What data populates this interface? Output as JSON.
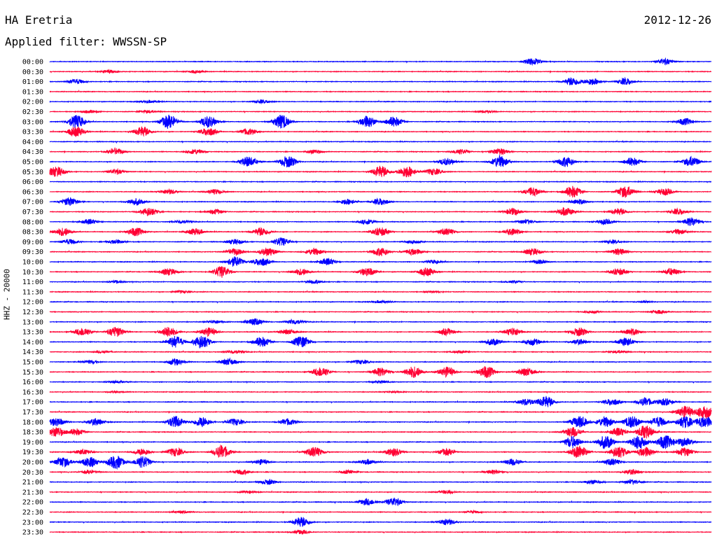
{
  "header": {
    "station": "HA Eretria",
    "date": "2012-12-26",
    "filter": "Applied filter: WWSSN-SP"
  },
  "axis_label": "HHZ - 20000",
  "colors": {
    "blue": "#0000ff",
    "red": "#ff0033",
    "text": "#000000"
  },
  "chart_data": {
    "type": "line",
    "title": "HA Eretria",
    "subtitle": "Applied filter: WWSSN-SP",
    "ylabel": "HHZ - 20000",
    "rows": [
      "00:00",
      "00:30",
      "01:00",
      "01:30",
      "02:00",
      "02:30",
      "03:00",
      "03:30",
      "04:00",
      "04:30",
      "05:00",
      "05:30",
      "06:00",
      "06:30",
      "07:00",
      "07:30",
      "08:00",
      "08:30",
      "09:00",
      "09:30",
      "10:00",
      "10:30",
      "11:00",
      "11:30",
      "12:00",
      "12:30",
      "13:00",
      "13:30",
      "14:00",
      "14:30",
      "15:00",
      "15:30",
      "16:00",
      "16:30",
      "17:00",
      "17:30",
      "18:00",
      "18:30",
      "19:00",
      "19:30",
      "20:00",
      "20:30",
      "21:00",
      "21:30",
      "22:00",
      "22:30",
      "23:00",
      "23:30"
    ],
    "row_colors": [
      "blue",
      "red"
    ],
    "bursts": [
      [
        [
          0.73,
          0.8
        ],
        [
          0.93,
          0.7
        ]
      ],
      [
        [
          0.09,
          0.4
        ],
        [
          0.22,
          0.3
        ]
      ],
      [
        [
          0.04,
          0.6
        ],
        [
          0.79,
          1.0
        ],
        [
          0.82,
          0.8
        ],
        [
          0.87,
          0.8
        ]
      ],
      [],
      [
        [
          0.15,
          0.3
        ],
        [
          0.32,
          0.4
        ]
      ],
      [
        [
          0.06,
          0.4
        ],
        [
          0.15,
          0.3
        ],
        [
          0.66,
          0.3
        ]
      ],
      [
        [
          0.04,
          1.6
        ],
        [
          0.18,
          1.6
        ],
        [
          0.24,
          1.4
        ],
        [
          0.35,
          1.6
        ],
        [
          0.48,
          1.4
        ],
        [
          0.52,
          1.2
        ],
        [
          0.96,
          0.8
        ]
      ],
      [
        [
          0.04,
          1.2
        ],
        [
          0.14,
          1.2
        ],
        [
          0.24,
          1.0
        ],
        [
          0.3,
          0.8
        ]
      ],
      [],
      [
        [
          0.1,
          0.8
        ],
        [
          0.22,
          0.6
        ],
        [
          0.4,
          0.5
        ],
        [
          0.62,
          0.6
        ],
        [
          0.68,
          0.8
        ]
      ],
      [
        [
          0.3,
          1.2
        ],
        [
          0.36,
          1.4
        ],
        [
          0.6,
          0.8
        ],
        [
          0.68,
          1.4
        ],
        [
          0.78,
          1.2
        ],
        [
          0.88,
          1.0
        ],
        [
          0.97,
          1.2
        ]
      ],
      [
        [
          0.01,
          1.2
        ],
        [
          0.1,
          0.6
        ],
        [
          0.5,
          1.4
        ],
        [
          0.54,
          1.4
        ],
        [
          0.58,
          0.8
        ]
      ],
      [],
      [
        [
          0.18,
          0.6
        ],
        [
          0.25,
          0.6
        ],
        [
          0.73,
          1.0
        ],
        [
          0.79,
          1.4
        ],
        [
          0.87,
          1.4
        ],
        [
          0.93,
          0.8
        ]
      ],
      [
        [
          0.03,
          1.0
        ],
        [
          0.13,
          0.8
        ],
        [
          0.45,
          0.7
        ],
        [
          0.5,
          0.8
        ],
        [
          0.8,
          0.6
        ]
      ],
      [
        [
          0.15,
          1.0
        ],
        [
          0.25,
          0.6
        ],
        [
          0.7,
          0.8
        ],
        [
          0.78,
          1.0
        ],
        [
          0.86,
          0.8
        ],
        [
          0.95,
          0.7
        ]
      ],
      [
        [
          0.06,
          0.6
        ],
        [
          0.2,
          0.4
        ],
        [
          0.48,
          0.6
        ],
        [
          0.72,
          0.5
        ],
        [
          0.84,
          0.6
        ],
        [
          0.97,
          1.0
        ]
      ],
      [
        [
          0.02,
          1.0
        ],
        [
          0.13,
          1.0
        ],
        [
          0.22,
          0.8
        ],
        [
          0.32,
          1.0
        ],
        [
          0.5,
          1.0
        ],
        [
          0.6,
          0.8
        ],
        [
          0.7,
          0.8
        ],
        [
          0.95,
          0.6
        ]
      ],
      [
        [
          0.03,
          0.6
        ],
        [
          0.1,
          0.5
        ],
        [
          0.28,
          0.6
        ],
        [
          0.35,
          1.0
        ],
        [
          0.55,
          0.4
        ],
        [
          0.85,
          0.4
        ]
      ],
      [
        [
          0.28,
          0.8
        ],
        [
          0.33,
          1.0
        ],
        [
          0.4,
          0.8
        ],
        [
          0.5,
          1.0
        ],
        [
          0.55,
          0.8
        ],
        [
          0.73,
          0.8
        ],
        [
          0.86,
          0.8
        ]
      ],
      [
        [
          0.28,
          1.2
        ],
        [
          0.32,
          1.0
        ],
        [
          0.42,
          0.8
        ],
        [
          0.58,
          0.4
        ],
        [
          0.74,
          0.5
        ]
      ],
      [
        [
          0.18,
          0.8
        ],
        [
          0.26,
          1.4
        ],
        [
          0.38,
          0.8
        ],
        [
          0.48,
          1.0
        ],
        [
          0.57,
          1.0
        ],
        [
          0.86,
          0.8
        ],
        [
          0.94,
          0.8
        ]
      ],
      [
        [
          0.1,
          0.3
        ],
        [
          0.4,
          0.4
        ],
        [
          0.7,
          0.3
        ]
      ],
      [
        [
          0.2,
          0.3
        ],
        [
          0.58,
          0.2
        ]
      ],
      [
        [
          0.5,
          0.3
        ],
        [
          0.9,
          0.2
        ]
      ],
      [
        [
          0.82,
          0.3
        ],
        [
          0.92,
          0.4
        ]
      ],
      [
        [
          0.25,
          0.4
        ],
        [
          0.31,
          0.8
        ],
        [
          0.37,
          0.6
        ]
      ],
      [
        [
          0.05,
          1.0
        ],
        [
          0.1,
          1.2
        ],
        [
          0.18,
          1.2
        ],
        [
          0.24,
          1.0
        ],
        [
          0.36,
          0.6
        ],
        [
          0.6,
          0.8
        ],
        [
          0.7,
          1.0
        ],
        [
          0.8,
          1.0
        ],
        [
          0.88,
          0.8
        ]
      ],
      [
        [
          0.19,
          1.4
        ],
        [
          0.23,
          1.6
        ],
        [
          0.32,
          1.2
        ],
        [
          0.38,
          1.4
        ],
        [
          0.67,
          0.8
        ],
        [
          0.73,
          0.8
        ],
        [
          0.8,
          0.6
        ],
        [
          0.87,
          1.0
        ]
      ],
      [
        [
          0.08,
          0.3
        ],
        [
          0.28,
          0.4
        ],
        [
          0.62,
          0.3
        ],
        [
          0.86,
          0.3
        ]
      ],
      [
        [
          0.06,
          0.4
        ],
        [
          0.19,
          0.8
        ],
        [
          0.27,
          0.8
        ],
        [
          0.47,
          0.5
        ]
      ],
      [
        [
          0.41,
          1.2
        ],
        [
          0.5,
          1.0
        ],
        [
          0.55,
          1.4
        ],
        [
          0.6,
          1.2
        ],
        [
          0.66,
          1.4
        ],
        [
          0.72,
          1.0
        ]
      ],
      [
        [
          0.1,
          0.3
        ],
        [
          0.5,
          0.3
        ]
      ],
      [
        [
          0.1,
          0.2
        ],
        [
          0.52,
          0.2
        ]
      ],
      [
        [
          0.72,
          0.8
        ],
        [
          0.75,
          1.4
        ],
        [
          0.85,
          0.8
        ],
        [
          0.9,
          1.0
        ],
        [
          0.93,
          0.8
        ]
      ],
      [
        [
          0.96,
          1.4
        ],
        [
          0.99,
          1.6
        ]
      ],
      [
        [
          0.01,
          1.0
        ],
        [
          0.07,
          0.8
        ],
        [
          0.19,
          1.4
        ],
        [
          0.23,
          1.2
        ],
        [
          0.28,
          0.8
        ],
        [
          0.36,
          0.8
        ],
        [
          0.8,
          1.4
        ],
        [
          0.84,
          1.2
        ],
        [
          0.88,
          1.4
        ],
        [
          0.92,
          1.2
        ],
        [
          0.96,
          1.4
        ],
        [
          0.99,
          1.4
        ]
      ],
      [
        [
          0.01,
          1.2
        ],
        [
          0.04,
          0.8
        ],
        [
          0.79,
          1.2
        ],
        [
          0.86,
          1.0
        ],
        [
          0.9,
          1.6
        ]
      ],
      [
        [
          0.79,
          1.4
        ],
        [
          0.84,
          1.6
        ],
        [
          0.89,
          1.6
        ],
        [
          0.93,
          1.6
        ],
        [
          0.96,
          1.0
        ]
      ],
      [
        [
          0.05,
          0.6
        ],
        [
          0.14,
          0.8
        ],
        [
          0.19,
          1.0
        ],
        [
          0.26,
          1.6
        ],
        [
          0.4,
          1.2
        ],
        [
          0.52,
          1.0
        ],
        [
          0.6,
          0.8
        ],
        [
          0.8,
          1.6
        ],
        [
          0.86,
          1.4
        ],
        [
          0.9,
          1.2
        ],
        [
          0.96,
          1.0
        ]
      ],
      [
        [
          0.02,
          1.2
        ],
        [
          0.06,
          1.2
        ],
        [
          0.1,
          1.6
        ],
        [
          0.14,
          1.4
        ],
        [
          0.32,
          0.6
        ],
        [
          0.48,
          0.6
        ],
        [
          0.7,
          0.8
        ],
        [
          0.85,
          0.8
        ]
      ],
      [
        [
          0.06,
          0.4
        ],
        [
          0.29,
          0.6
        ],
        [
          0.45,
          0.4
        ],
        [
          0.67,
          0.5
        ],
        [
          0.88,
          0.6
        ]
      ],
      [
        [
          0.33,
          0.6
        ],
        [
          0.82,
          0.5
        ],
        [
          0.88,
          0.5
        ]
      ],
      [
        [
          0.3,
          0.3
        ],
        [
          0.6,
          0.4
        ]
      ],
      [
        [
          0.48,
          0.8
        ],
        [
          0.52,
          1.0
        ]
      ],
      [
        [
          0.2,
          0.3
        ],
        [
          0.64,
          0.3
        ]
      ],
      [
        [
          0.38,
          1.2
        ],
        [
          0.6,
          0.8
        ]
      ],
      [
        [
          0.38,
          0.5
        ]
      ]
    ]
  }
}
